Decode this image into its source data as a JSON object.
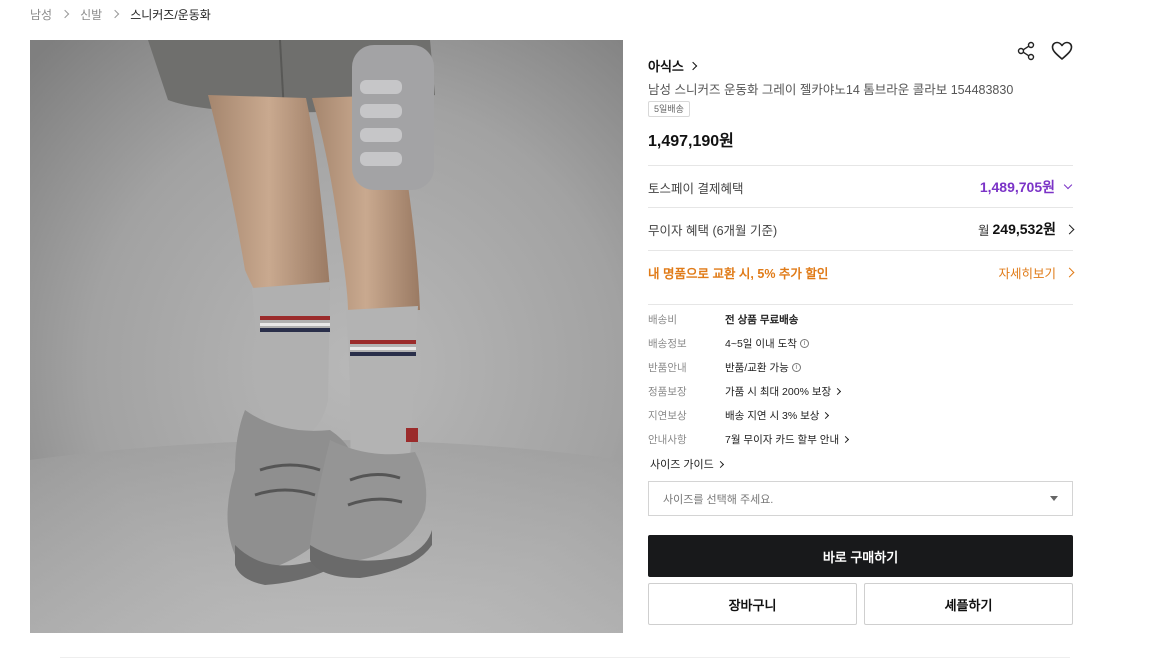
{
  "breadcrumb": {
    "items": [
      "남성",
      "신발",
      "스니커즈/운동화"
    ]
  },
  "product": {
    "brand": "아식스",
    "name": "남성 스니커즈 운동화 그레이 젤카야노14 톰브라운 콜라보 154483830",
    "badge": "5일배송",
    "price": "1,497,190원"
  },
  "benefits": {
    "toss_label": "토스페이 결제혜택",
    "toss_amount": "1,489,705원",
    "installment_label": "무이자 혜택 (6개월 기준)",
    "installment_prefix": "월",
    "installment_amount": "249,532원",
    "trade_in_label": "내 명품으로 교환 시, 5% 추가 할인",
    "trade_in_link": "자세히보기"
  },
  "specs": [
    {
      "key": "배송비",
      "value": "전 상품 무료배송"
    },
    {
      "key": "배송정보",
      "value": "4~5일 이내 도착"
    },
    {
      "key": "반품안내",
      "value": "반품/교환 가능"
    },
    {
      "key": "정품보장",
      "value": "가품 시 최대 200% 보장"
    },
    {
      "key": "지연보상",
      "value": "배송 지연 시 3% 보상"
    },
    {
      "key": "안내사항",
      "value": "7월 무이자 카드 할부 안내"
    }
  ],
  "size_guide": "사이즈 가이드",
  "size_select": {
    "placeholder": "사이즈를 선택해 주세요."
  },
  "buttons": {
    "buy": "바로 구매하기",
    "cart": "장바구니",
    "share": "셰플하기"
  },
  "icons": {
    "share": "share-icon",
    "wishlist": "heart-icon"
  },
  "colors": {
    "toss_purple": "#7b33c7",
    "trade_in_orange": "#e07b18",
    "buy_button": "#18191b"
  }
}
